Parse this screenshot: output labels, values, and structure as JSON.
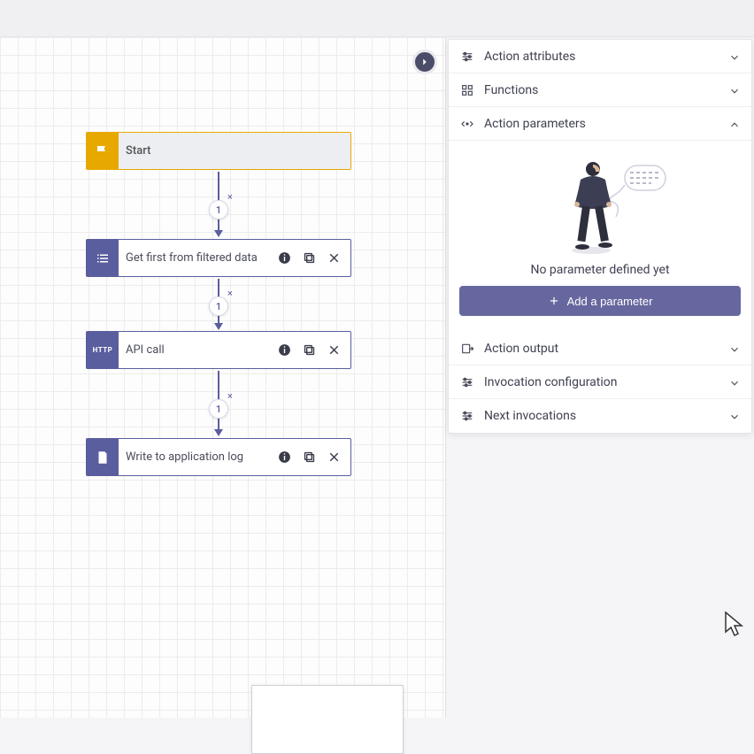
{
  "flow": {
    "nodes": [
      {
        "id": "start",
        "label": "Start",
        "kind": "start"
      },
      {
        "id": "filter",
        "label": "Get first from filtered data",
        "kind": "list"
      },
      {
        "id": "api",
        "label": "API call",
        "kind": "http"
      },
      {
        "id": "log",
        "label": "Write to application log",
        "kind": "file"
      }
    ],
    "edge_count": "1"
  },
  "panel": {
    "sections": {
      "action_attributes": "Action attributes",
      "functions": "Functions",
      "action_parameters": "Action parameters",
      "action_output": "Action output",
      "invocation_config": "Invocation configuration",
      "next_invocations": "Next invocations"
    },
    "parameters": {
      "empty_text": "No parameter defined yet",
      "add_button": "Add a parameter"
    }
  }
}
